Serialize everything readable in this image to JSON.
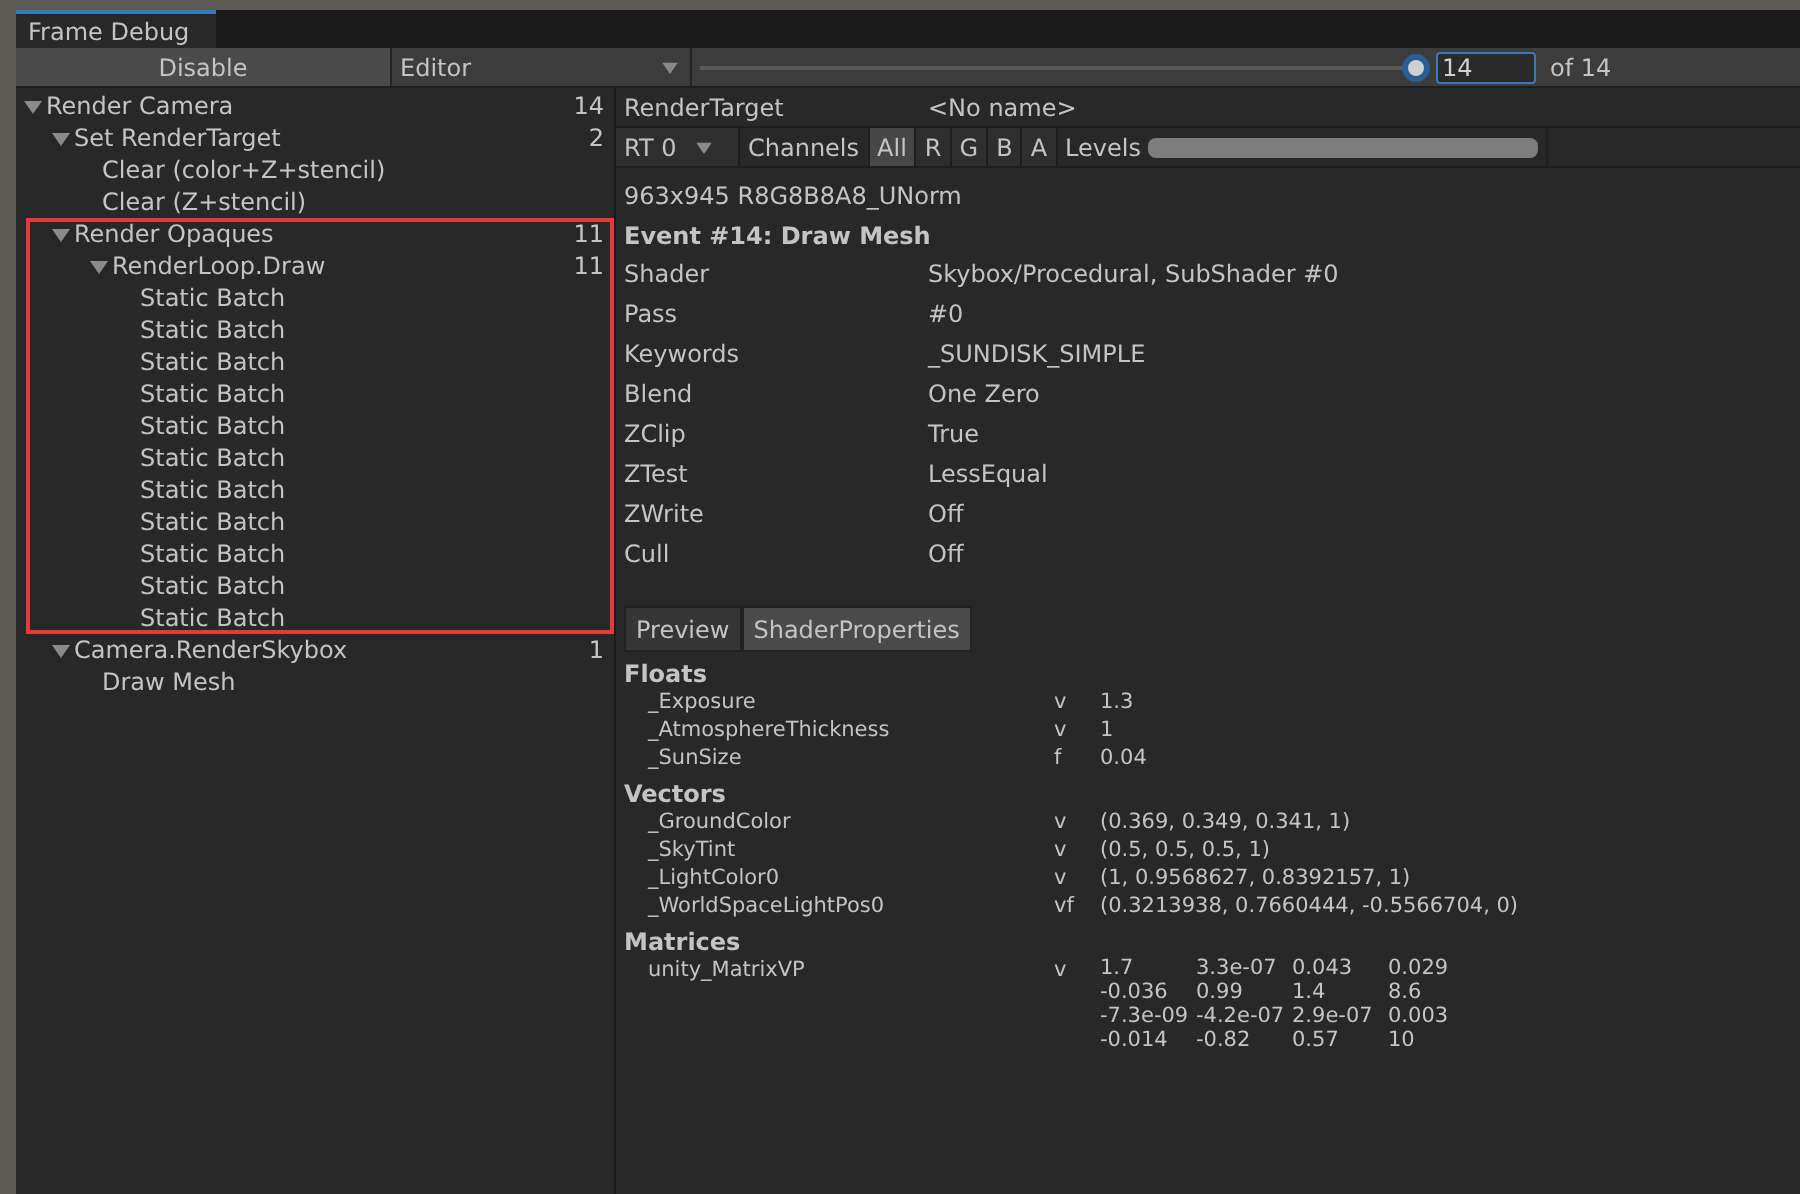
{
  "window": {
    "tab": "Frame Debug"
  },
  "toolbar": {
    "enable_button": "Disable",
    "target": "Editor",
    "event_slider": {
      "level": 1
    },
    "event_field": "14",
    "event_total": "of 14"
  },
  "tree": [
    {
      "label": "Render Camera",
      "count": "14",
      "expanded": true,
      "children": [
        {
          "label": "Set RenderTarget",
          "count": "2",
          "expanded": true,
          "highlighted": false,
          "children": [
            {
              "label": "Clear (color+Z+stencil)"
            },
            {
              "label": "Clear (Z+stencil)"
            }
          ]
        },
        {
          "label": "Render Opaques",
          "count": "11",
          "expanded": true,
          "highlighted": true,
          "children": [
            {
              "label": "RenderLoop.Draw",
              "count": "11",
              "expanded": true,
              "children": [
                {
                  "label": "Static Batch"
                },
                {
                  "label": "Static Batch"
                },
                {
                  "label": "Static Batch"
                },
                {
                  "label": "Static Batch"
                },
                {
                  "label": "Static Batch"
                },
                {
                  "label": "Static Batch"
                },
                {
                  "label": "Static Batch"
                },
                {
                  "label": "Static Batch"
                },
                {
                  "label": "Static Batch"
                },
                {
                  "label": "Static Batch"
                },
                {
                  "label": "Static Batch"
                }
              ]
            }
          ]
        },
        {
          "label": "Camera.RenderSkybox",
          "count": "1",
          "expanded": true,
          "highlighted": false,
          "children": [
            {
              "label": "Draw Mesh"
            }
          ]
        }
      ]
    }
  ],
  "details": {
    "render_target": {
      "label": "RenderTarget",
      "value": "<No name>"
    },
    "rt_dropdown": "RT 0",
    "channels_label": "Channels",
    "channels": [
      {
        "label": "All",
        "selected": true
      },
      {
        "label": "R",
        "selected": false
      },
      {
        "label": "G",
        "selected": false
      },
      {
        "label": "B",
        "selected": false
      },
      {
        "label": "A",
        "selected": false
      }
    ],
    "levels_label": "Levels",
    "levels": {
      "level": 1
    },
    "format": "963x945 R8G8B8A8_UNorm",
    "event_title": "Event #14: Draw Mesh",
    "properties": [
      {
        "label": "Shader",
        "value": "Skybox/Procedural, SubShader #0"
      },
      {
        "label": "Pass",
        "value": "#0"
      },
      {
        "label": "Keywords",
        "value": "_SUNDISK_SIMPLE"
      },
      {
        "label": "Blend",
        "value": "One Zero"
      },
      {
        "label": "ZClip",
        "value": "True"
      },
      {
        "label": "ZTest",
        "value": "LessEqual"
      },
      {
        "label": "ZWrite",
        "value": "Off"
      },
      {
        "label": "Cull",
        "value": "Off"
      }
    ],
    "view_tabs": [
      {
        "label": "Preview",
        "selected": false
      },
      {
        "label": "ShaderProperties",
        "selected": true
      }
    ],
    "sections": [
      {
        "title": "Floats",
        "rows": [
          {
            "name": "_Exposure",
            "type": "v",
            "value": "1.3"
          },
          {
            "name": "_AtmosphereThickness",
            "type": "v",
            "value": "1"
          },
          {
            "name": "_SunSize",
            "type": "f",
            "value": "0.04"
          }
        ]
      },
      {
        "title": "Vectors",
        "rows": [
          {
            "name": "_GroundColor",
            "type": "v",
            "value": "(0.369, 0.349, 0.341, 1)"
          },
          {
            "name": "_SkyTint",
            "type": "v",
            "value": "(0.5, 0.5, 0.5, 1)"
          },
          {
            "name": "_LightColor0",
            "type": "v",
            "value": "(1, 0.9568627, 0.8392157, 1)"
          },
          {
            "name": "_WorldSpaceLightPos0",
            "type": "vf",
            "value": "(0.3213938, 0.7660444, -0.5566704, 0)"
          }
        ]
      },
      {
        "title": "Matrices",
        "rows": [
          {
            "name": "unity_MatrixVP",
            "type": "v",
            "matrix": [
              [
                "1.7",
                "3.3e-07",
                "0.043",
                "0.029"
              ],
              [
                "-0.036",
                "0.99",
                "1.4",
                "8.6"
              ],
              [
                "-7.3e-09",
                "-4.2e-07",
                "2.9e-07",
                "0.003"
              ],
              [
                "-0.014",
                "-0.82",
                "0.57",
                "10"
              ]
            ]
          }
        ]
      }
    ]
  }
}
